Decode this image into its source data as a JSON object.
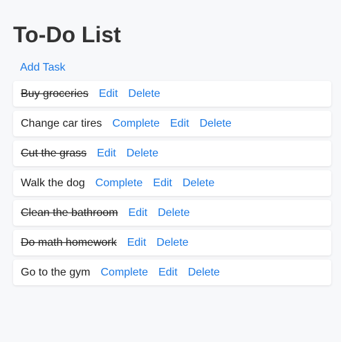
{
  "page": {
    "title": "To-Do List",
    "add_task_label": "Add Task"
  },
  "actions": {
    "complete": "Complete",
    "edit": "Edit",
    "delete": "Delete"
  },
  "tasks": [
    {
      "text": "Buy groceries",
      "completed": true
    },
    {
      "text": "Change car tires",
      "completed": false
    },
    {
      "text": "Cut the grass",
      "completed": true
    },
    {
      "text": "Walk the dog",
      "completed": false
    },
    {
      "text": "Clean the bathroom",
      "completed": true
    },
    {
      "text": "Do math homework",
      "completed": true
    },
    {
      "text": "Go to the gym",
      "completed": false
    }
  ],
  "colors": {
    "background": "#f7f8fa",
    "link": "#1e7be6",
    "title": "#333333",
    "card": "#ffffff"
  }
}
